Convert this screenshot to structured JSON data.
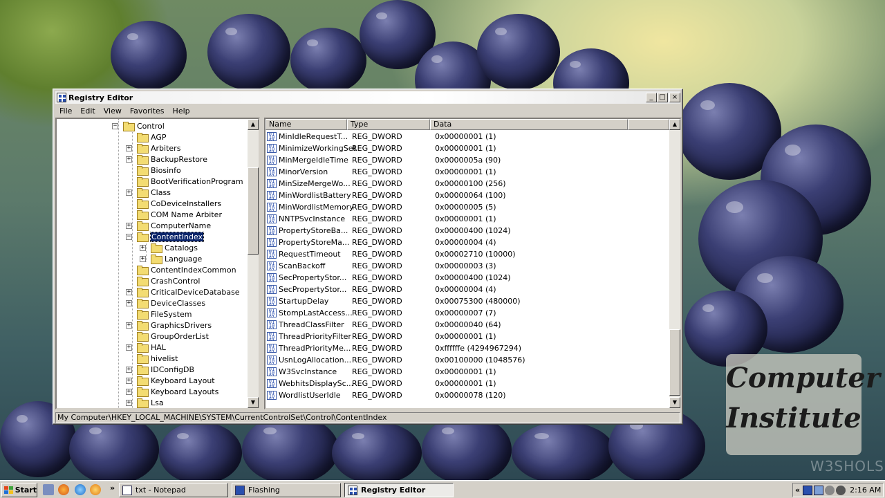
{
  "window": {
    "title": "Registry Editor",
    "minimize_label": "_",
    "maximize_label": "□",
    "close_label": "×"
  },
  "menu": [
    "File",
    "Edit",
    "View",
    "Favorites",
    "Help"
  ],
  "tree": {
    "items": [
      {
        "label": "Control",
        "expander": "−"
      },
      {
        "label": "AGP",
        "expander": ""
      },
      {
        "label": "Arbiters",
        "expander": "+"
      },
      {
        "label": "BackupRestore",
        "expander": "+"
      },
      {
        "label": "Biosinfo",
        "expander": ""
      },
      {
        "label": "BootVerificationProgram",
        "expander": ""
      },
      {
        "label": "Class",
        "expander": "+"
      },
      {
        "label": "CoDeviceInstallers",
        "expander": ""
      },
      {
        "label": "COM Name Arbiter",
        "expander": ""
      },
      {
        "label": "ComputerName",
        "expander": "+"
      },
      {
        "label": "ContentIndex",
        "expander": "−",
        "selected": true
      },
      {
        "label": "Catalogs",
        "expander": "+"
      },
      {
        "label": "Language",
        "expander": "+"
      },
      {
        "label": "ContentIndexCommon",
        "expander": ""
      },
      {
        "label": "CrashControl",
        "expander": ""
      },
      {
        "label": "CriticalDeviceDatabase",
        "expander": "+"
      },
      {
        "label": "DeviceClasses",
        "expander": "+"
      },
      {
        "label": "FileSystem",
        "expander": ""
      },
      {
        "label": "GraphicsDrivers",
        "expander": "+"
      },
      {
        "label": "GroupOrderList",
        "expander": ""
      },
      {
        "label": "HAL",
        "expander": "+"
      },
      {
        "label": "hivelist",
        "expander": ""
      },
      {
        "label": "IDConfigDB",
        "expander": "+"
      },
      {
        "label": "Keyboard Layout",
        "expander": "+"
      },
      {
        "label": "Keyboard Layouts",
        "expander": "+"
      },
      {
        "label": "Lsa",
        "expander": "+"
      }
    ]
  },
  "list": {
    "columns": {
      "name": "Name",
      "type": "Type",
      "data": "Data"
    },
    "rows": [
      {
        "name": "MinIdleRequestT...",
        "type": "REG_DWORD",
        "data": "0x00000001 (1)"
      },
      {
        "name": "MinimizeWorkingSet",
        "type": "REG_DWORD",
        "data": "0x00000001 (1)"
      },
      {
        "name": "MinMergeIdleTime",
        "type": "REG_DWORD",
        "data": "0x0000005a (90)"
      },
      {
        "name": "MinorVersion",
        "type": "REG_DWORD",
        "data": "0x00000001 (1)"
      },
      {
        "name": "MinSizeMergeWo...",
        "type": "REG_DWORD",
        "data": "0x00000100 (256)"
      },
      {
        "name": "MinWordlistBattery",
        "type": "REG_DWORD",
        "data": "0x00000064 (100)"
      },
      {
        "name": "MinWordlistMemory",
        "type": "REG_DWORD",
        "data": "0x00000005 (5)"
      },
      {
        "name": "NNTPSvcInstance",
        "type": "REG_DWORD",
        "data": "0x00000001 (1)"
      },
      {
        "name": "PropertyStoreBa...",
        "type": "REG_DWORD",
        "data": "0x00000400 (1024)"
      },
      {
        "name": "PropertyStoreMa...",
        "type": "REG_DWORD",
        "data": "0x00000004 (4)"
      },
      {
        "name": "RequestTimeout",
        "type": "REG_DWORD",
        "data": "0x00002710 (10000)"
      },
      {
        "name": "ScanBackoff",
        "type": "REG_DWORD",
        "data": "0x00000003 (3)"
      },
      {
        "name": "SecPropertyStor...",
        "type": "REG_DWORD",
        "data": "0x00000400 (1024)"
      },
      {
        "name": "SecPropertyStor...",
        "type": "REG_DWORD",
        "data": "0x00000004 (4)"
      },
      {
        "name": "StartupDelay",
        "type": "REG_DWORD",
        "data": "0x00075300 (480000)"
      },
      {
        "name": "StompLastAccess...",
        "type": "REG_DWORD",
        "data": "0x00000007 (7)"
      },
      {
        "name": "ThreadClassFilter",
        "type": "REG_DWORD",
        "data": "0x00000040 (64)"
      },
      {
        "name": "ThreadPriorityFilter",
        "type": "REG_DWORD",
        "data": "0x00000001 (1)"
      },
      {
        "name": "ThreadPriorityMe...",
        "type": "REG_DWORD",
        "data": "0xffffffe (4294967294)"
      },
      {
        "name": "UsnLogAllocation...",
        "type": "REG_DWORD",
        "data": "0x00100000 (1048576)"
      },
      {
        "name": "W3SvcInstance",
        "type": "REG_DWORD",
        "data": "0x00000001 (1)"
      },
      {
        "name": "WebhitsDisplaySc...",
        "type": "REG_DWORD",
        "data": "0x00000001 (1)"
      },
      {
        "name": "WordlistUserIdle",
        "type": "REG_DWORD",
        "data": "0x00000078 (120)"
      }
    ]
  },
  "status": "My Computer\\HKEY_LOCAL_MACHINE\\SYSTEM\\CurrentControlSet\\Control\\ContentIndex",
  "taskbar": {
    "start_label": "Start",
    "overflow_label": "»",
    "tasks": [
      {
        "label": "txt - Notepad"
      },
      {
        "label": "Flashing"
      },
      {
        "label": "Registry Editor",
        "active": true
      }
    ],
    "tray_overflow": "«",
    "clock": "2:16 AM"
  },
  "logo": {
    "line1": "Computer",
    "line2": "Institute"
  },
  "watermark": "W3SHOLS",
  "colors": {
    "selection": "#0a246a",
    "chrome": "#d4d0c8"
  }
}
